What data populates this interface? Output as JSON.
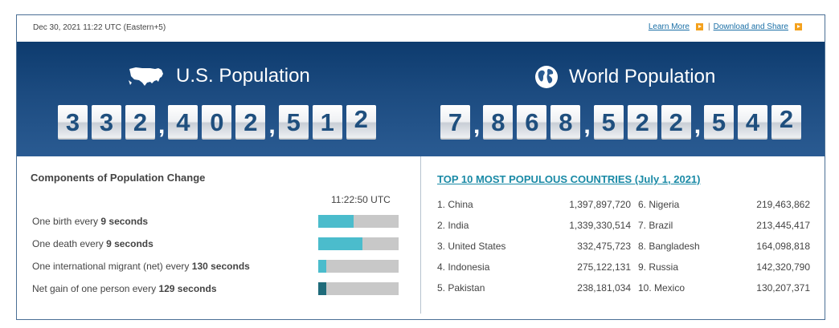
{
  "header": {
    "timestamp": "Dec 30, 2021 11:22 UTC (Eastern+5)",
    "learn_more": "Learn More",
    "download_share": "Download and Share",
    "separator": "|"
  },
  "us": {
    "title": "U.S. Population",
    "digits": [
      "3",
      "3",
      "2",
      ",",
      "4",
      "0",
      "2",
      ",",
      "5",
      "1",
      "2"
    ]
  },
  "world": {
    "title": "World Population",
    "digits": [
      "7",
      ",",
      "8",
      "6",
      "8",
      ",",
      "5",
      "2",
      "2",
      ",",
      "5",
      "4",
      "2"
    ]
  },
  "components": {
    "title": "Components of Population Change",
    "time": "11:22:50 UTC",
    "rows": [
      {
        "prefix": "One birth every",
        "value": "9 seconds",
        "fill": 0.44
      },
      {
        "prefix": "One death every",
        "value": "9 seconds",
        "fill": 0.55
      },
      {
        "prefix": "One international migrant (net) every",
        "value": "130 seconds",
        "fill": 0.1
      },
      {
        "prefix": "Net gain of one person every",
        "value": "129 seconds",
        "fill": 0.1
      }
    ]
  },
  "countries": {
    "title": "TOP 10 MOST POPULOUS COUNTRIES (July 1, 2021)",
    "left": [
      {
        "name": "1. China",
        "pop": "1,397,897,720"
      },
      {
        "name": "2. India",
        "pop": "1,339,330,514"
      },
      {
        "name": "3. United States",
        "pop": "332,475,723"
      },
      {
        "name": "4. Indonesia",
        "pop": "275,122,131"
      },
      {
        "name": "5. Pakistan",
        "pop": "238,181,034"
      }
    ],
    "right": [
      {
        "name": "6. Nigeria",
        "pop": "219,463,862"
      },
      {
        "name": "7. Brazil",
        "pop": "213,445,417"
      },
      {
        "name": "8. Bangladesh",
        "pop": "164,098,818"
      },
      {
        "name": "9. Russia",
        "pop": "142,320,790"
      },
      {
        "name": "10. Mexico",
        "pop": "130,207,371"
      }
    ]
  },
  "colors": {
    "banner": "#1c4b80",
    "bar_fill": "#4bbccc",
    "bar_fill_dark": "#1f6b7a",
    "link": "#1a6fa6"
  }
}
